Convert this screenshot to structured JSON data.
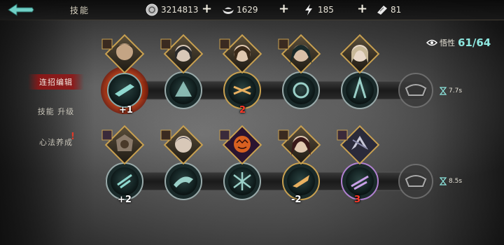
{
  "header": {
    "title": "技能",
    "resources": [
      {
        "icon": "coin-icon",
        "value": "3214813"
      },
      {
        "icon": "ingot-icon",
        "value": "1629"
      },
      {
        "icon": "stamina-bolt-icon",
        "value": "185"
      },
      {
        "icon": "ticket-icon",
        "value": "81"
      }
    ]
  },
  "sidebar": {
    "items": [
      {
        "label": "连招编辑",
        "active": true
      },
      {
        "label": "技能 升级",
        "active": false
      },
      {
        "label": "心法养成",
        "active": false,
        "alert": "!"
      }
    ]
  },
  "comprehension": {
    "label": "悟性",
    "value": "61/64"
  },
  "rows": [
    {
      "timer": "7.7s",
      "badges": [
        {
          "text": "+1",
          "color": "white"
        },
        {
          "text": "2",
          "color": "red"
        }
      ]
    },
    {
      "timer": "8.5s",
      "badges": [
        {
          "text": "+2",
          "color": "white"
        },
        {
          "text": "-2",
          "color": "white"
        },
        {
          "text": "3",
          "color": "red"
        }
      ]
    }
  ],
  "colors": {
    "accent": "#8ee8e0",
    "frame_gold": "#c8a050",
    "active_red": "#a01818"
  }
}
